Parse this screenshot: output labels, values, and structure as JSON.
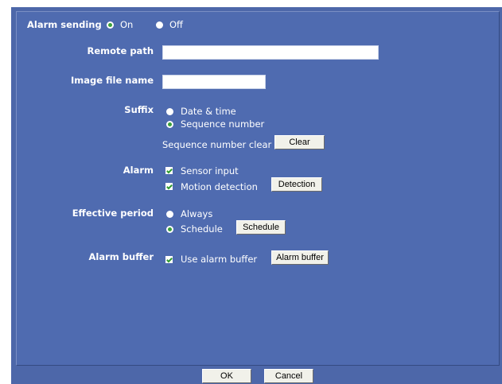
{
  "alarm_sending": {
    "label": "Alarm sending",
    "on": "On",
    "off": "Off",
    "selected": "On"
  },
  "remote_path": {
    "label": "Remote path",
    "value": ""
  },
  "image_file_name": {
    "label": "Image file name",
    "value": ""
  },
  "suffix": {
    "label": "Suffix",
    "options": [
      "Date & time",
      "Sequence number"
    ],
    "selected": "Sequence number",
    "seq_clear_label": "Sequence number clear",
    "clear_button": "Clear"
  },
  "alarm": {
    "label": "Alarm",
    "sensor_input": "Sensor input",
    "motion_detection": "Motion detection",
    "detection_button": "Detection"
  },
  "effective_period": {
    "label": "Effective period",
    "always": "Always",
    "schedule": "Schedule",
    "selected": "Schedule",
    "schedule_button": "Schedule"
  },
  "alarm_buffer": {
    "label": "Alarm buffer",
    "use_label": "Use alarm buffer",
    "button": "Alarm buffer"
  },
  "footer": {
    "ok": "OK",
    "cancel": "Cancel"
  },
  "colors": {
    "background": "#4f6bb0",
    "check_accent": "#2e9a2e"
  }
}
